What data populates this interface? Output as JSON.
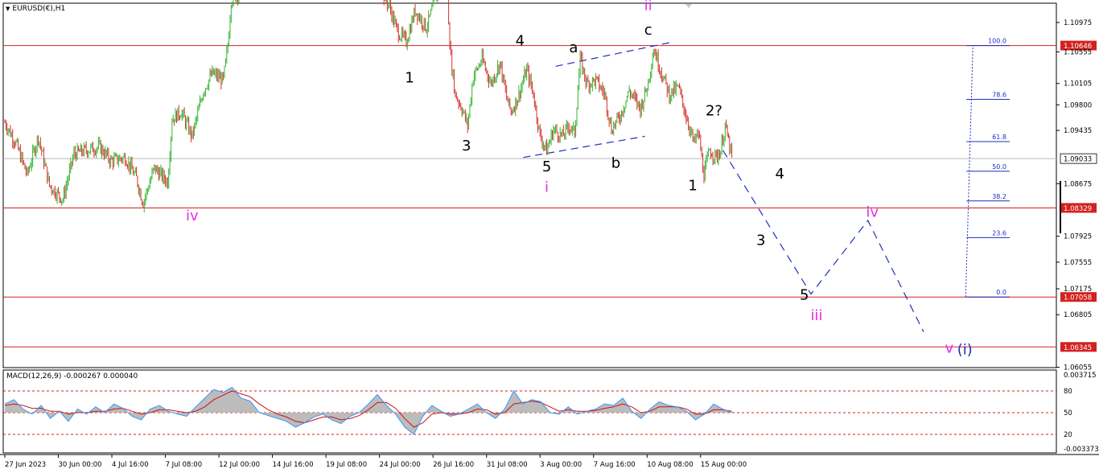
{
  "header": {
    "symbol_label": "EURUSD(€),H1",
    "menu_arrow_icon": "triangle-down-icon"
  },
  "colors": {
    "bull": "#2fb52f",
    "bear": "#d4312c",
    "level_line": "#d42020",
    "price_line": "#b8b8b8",
    "wave_black": "#000000",
    "wave_magenta": "#e62ee6",
    "projection": "#1f2fbd",
    "macd_line": "#3399ff",
    "macd_hist": "#b0b0b0",
    "signal_line": "#cc1111"
  },
  "chart_data": [
    {
      "type": "line",
      "title": "EURUSD(€),H1",
      "ylim": [
        1.0605,
        1.1125
      ],
      "x_tick_labels": [
        "27 Jun 2023",
        "30 Jun 00:00",
        "4 Jul 16:00",
        "7 Jul 08:00",
        "12 Jul 00:00",
        "14 Jul 16:00",
        "19 Jul 08:00",
        "24 Jul 00:00",
        "26 Jul 16:00",
        "31 Jul 08:00",
        "3 Aug 00:00",
        "7 Aug 16:00",
        "10 Aug 08:00",
        "15 Aug 00:00"
      ],
      "x_tick_index": [
        0,
        48,
        96,
        144,
        192,
        240,
        288,
        336,
        384,
        432,
        480,
        528,
        576,
        624
      ],
      "bars_total": 640,
      "y_ticks": [
        "1.10975",
        "1.10555",
        "1.10105",
        "1.09800",
        "1.09435",
        "1.08675",
        "1.07925",
        "1.07555",
        "1.07175",
        "1.06805",
        "1.06055"
      ],
      "current_price": 1.09033,
      "current_price_label": "1.09033",
      "horizontal_levels": [
        {
          "value": 1.10646,
          "label": "1.10646"
        },
        {
          "value": 1.08329,
          "label": "1.08329"
        },
        {
          "value": 1.07058,
          "label": "1.07058"
        },
        {
          "value": 1.06345,
          "label": "1.06345"
        }
      ],
      "price_path": [
        [
          0,
          1.0955
        ],
        [
          10,
          1.0925
        ],
        [
          20,
          1.088
        ],
        [
          30,
          1.0935
        ],
        [
          40,
          1.0865
        ],
        [
          52,
          1.0845
        ],
        [
          62,
          1.091
        ],
        [
          72,
          1.0915
        ],
        [
          85,
          1.092
        ],
        [
          95,
          1.09
        ],
        [
          108,
          1.0905
        ],
        [
          118,
          1.0875
        ],
        [
          124,
          1.084
        ],
        [
          134,
          1.089
        ],
        [
          146,
          1.087
        ],
        [
          150,
          1.096
        ],
        [
          158,
          1.097
        ],
        [
          168,
          1.0935
        ],
        [
          178,
          1.1
        ],
        [
          186,
          1.1025
        ],
        [
          196,
          1.1015
        ],
        [
          200,
          1.1065
        ],
        [
          203,
          1.113
        ],
        [
          225,
          1.116
        ],
        [
          260,
          1.118
        ],
        [
          300,
          1.119
        ],
        [
          328,
          1.118
        ],
        [
          340,
          1.1135
        ],
        [
          345,
          1.112
        ],
        [
          352,
          1.1085
        ],
        [
          360,
          1.107
        ],
        [
          368,
          1.1115
        ],
        [
          378,
          1.109
        ],
        [
          386,
          1.113
        ],
        [
          393,
          1.1155
        ],
        [
          397,
          1.113
        ],
        [
          400,
          1.1045
        ],
        [
          404,
          1.0995
        ],
        [
          410,
          1.0975
        ],
        [
          415,
          1.095
        ],
        [
          420,
          1.102
        ],
        [
          428,
          1.1045
        ],
        [
          436,
          1.101
        ],
        [
          444,
          1.104
        ],
        [
          450,
          1.099
        ],
        [
          454,
          1.097
        ],
        [
          460,
          1.099
        ],
        [
          468,
          1.103
        ],
        [
          474,
          1.0995
        ],
        [
          480,
          1.0935
        ],
        [
          486,
          1.0915
        ],
        [
          492,
          1.0945
        ],
        [
          500,
          1.0935
        ],
        [
          506,
          1.095
        ],
        [
          511,
          1.094
        ],
        [
          516,
          1.1045
        ],
        [
          522,
          1.101
        ],
        [
          530,
          1.1015
        ],
        [
          538,
          1.0995
        ],
        [
          544,
          1.0945
        ],
        [
          552,
          1.0965
        ],
        [
          560,
          1.1
        ],
        [
          570,
          1.0975
        ],
        [
          576,
          1.1005
        ],
        [
          582,
          1.106
        ],
        [
          588,
          1.103
        ],
        [
          596,
          1.0995
        ],
        [
          604,
          1.1005
        ],
        [
          610,
          1.097
        ],
        [
          618,
          1.0925
        ],
        [
          622,
          1.094
        ],
        [
          627,
          1.088
        ],
        [
          632,
          1.0915
        ],
        [
          638,
          1.0905
        ],
        [
          642,
          1.0915
        ],
        [
          646,
          1.095
        ],
        [
          652,
          1.0905
        ]
      ],
      "waves": [
        {
          "label": "iv",
          "bar": 168,
          "price": 1.0815,
          "color": "magenta"
        },
        {
          "label": "1",
          "bar": 363,
          "price": 1.1012,
          "color": "black"
        },
        {
          "label": "3",
          "bar": 414,
          "price": 1.0915,
          "color": "black"
        },
        {
          "label": "4",
          "bar": 462,
          "price": 1.1065,
          "color": "black"
        },
        {
          "label": "5",
          "bar": 486,
          "price": 1.0885,
          "color": "black"
        },
        {
          "label": "i",
          "bar": 486,
          "price": 1.0856,
          "color": "magenta"
        },
        {
          "label": "a",
          "bar": 510,
          "price": 1.1055,
          "color": "black"
        },
        {
          "label": "b",
          "bar": 548,
          "price": 1.089,
          "color": "black"
        },
        {
          "label": "ii",
          "bar": 577,
          "price": 1.1115,
          "color": "magenta"
        },
        {
          "label": "c",
          "bar": 577,
          "price": 1.108,
          "color": "black"
        },
        {
          "label": "2?",
          "bar": 636,
          "price": 1.0965,
          "color": "black"
        },
        {
          "label": "1",
          "bar": 617,
          "price": 1.0858,
          "color": "black"
        },
        {
          "label": "4",
          "bar": 695,
          "price": 1.0875,
          "color": "black"
        },
        {
          "label": "3",
          "bar": 678,
          "price": 1.078,
          "color": "black"
        },
        {
          "label": "5",
          "bar": 717,
          "price": 1.0702,
          "color": "black"
        },
        {
          "label": "iii",
          "bar": 728,
          "price": 1.0673,
          "color": "magenta"
        },
        {
          "label": "iv",
          "bar": 778,
          "price": 1.082,
          "color": "magenta"
        },
        {
          "label": "v",
          "bar": 847,
          "price": 1.0626,
          "color": "magenta"
        },
        {
          "label": "(i)",
          "bar": 861,
          "price": 1.0624,
          "color": "blue"
        }
      ],
      "channel_lines": [
        {
          "from": [
            494,
            1.1035
          ],
          "to": [
            600,
            1.107
          ]
        },
        {
          "from": [
            465,
            1.0905
          ],
          "to": [
            574,
            1.0935
          ]
        }
      ],
      "projection_path": [
        [
          644,
          1.0915
        ],
        [
          723,
          1.071
        ],
        [
          774,
          1.0815
        ],
        [
          824,
          1.0656
        ]
      ],
      "fibonacci": {
        "base_bar": 861,
        "high": 1.10646,
        "low": 1.07058,
        "levels": [
          {
            "ratio": 1.0,
            "label": "100.0"
          },
          {
            "ratio": 0.786,
            "label": "78.6"
          },
          {
            "ratio": 0.618,
            "label": "61.8"
          },
          {
            "ratio": 0.5,
            "label": "50.0"
          },
          {
            "ratio": 0.382,
            "label": "38.2"
          },
          {
            "ratio": 0.236,
            "label": "23.6"
          },
          {
            "ratio": 0.0,
            "label": "0.0"
          }
        ]
      }
    },
    {
      "type": "line",
      "title": "MACD(12,26,9) -0.000267 0.000040",
      "ylim": [
        -0.0004,
        0.0004
      ],
      "y_ticks": [
        "0.003715",
        "80",
        "50",
        "20",
        "-0.003373"
      ],
      "level_lines": [
        80,
        50,
        20
      ],
      "series": [
        {
          "name": "MACD",
          "values": [
            62,
            68,
            55,
            48,
            60,
            42,
            52,
            38,
            55,
            48,
            58,
            50,
            62,
            56,
            45,
            40,
            55,
            60,
            52,
            48,
            45,
            58,
            70,
            82,
            78,
            85,
            70,
            66,
            50,
            46,
            42,
            38,
            30,
            36,
            44,
            48,
            40,
            35,
            45,
            50,
            62,
            75,
            60,
            48,
            30,
            20,
            45,
            60,
            52,
            45,
            48,
            55,
            62,
            50,
            42,
            55,
            80,
            62,
            68,
            65,
            50,
            48,
            58,
            48,
            52,
            55,
            62,
            60,
            70,
            52,
            42,
            55,
            65,
            60,
            58,
            52,
            40,
            48,
            62,
            55,
            50
          ]
        },
        {
          "name": "Signal",
          "values": [
            60,
            62,
            60,
            56,
            56,
            52,
            52,
            48,
            50,
            50,
            52,
            52,
            55,
            56,
            52,
            48,
            50,
            54,
            54,
            52,
            50,
            52,
            58,
            68,
            74,
            80,
            76,
            72,
            62,
            54,
            48,
            44,
            38,
            36,
            40,
            44,
            44,
            40,
            42,
            46,
            54,
            64,
            64,
            56,
            42,
            30,
            36,
            48,
            50,
            48,
            48,
            50,
            55,
            54,
            48,
            50,
            62,
            64,
            66,
            64,
            58,
            52,
            54,
            52,
            52,
            53,
            56,
            58,
            62,
            58,
            50,
            52,
            58,
            58,
            58,
            55,
            48,
            48,
            54,
            54,
            52
          ]
        }
      ]
    }
  ]
}
